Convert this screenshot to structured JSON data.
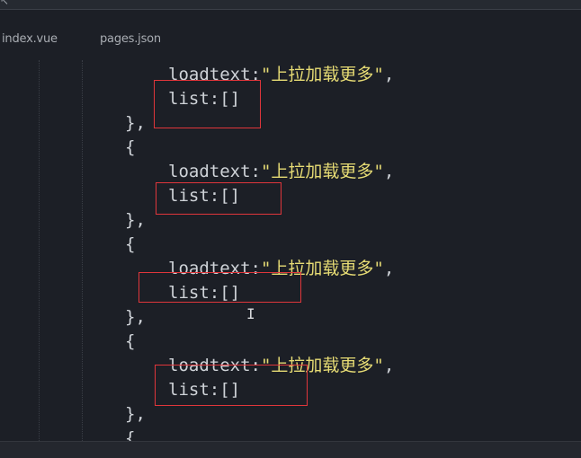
{
  "window": {
    "top_glyph": "↖"
  },
  "tabs": [
    {
      "label": "index.vue"
    },
    {
      "label": "pages.json"
    }
  ],
  "code": {
    "key_loadtext": "loadtext",
    "colon": ":",
    "loadtext_value": "\"上拉加载更多\"",
    "comma": ",",
    "list_line": "list:[]",
    "close_brace": "},",
    "open_brace": "{"
  },
  "annotation": {
    "box_color": "#e0363b"
  }
}
